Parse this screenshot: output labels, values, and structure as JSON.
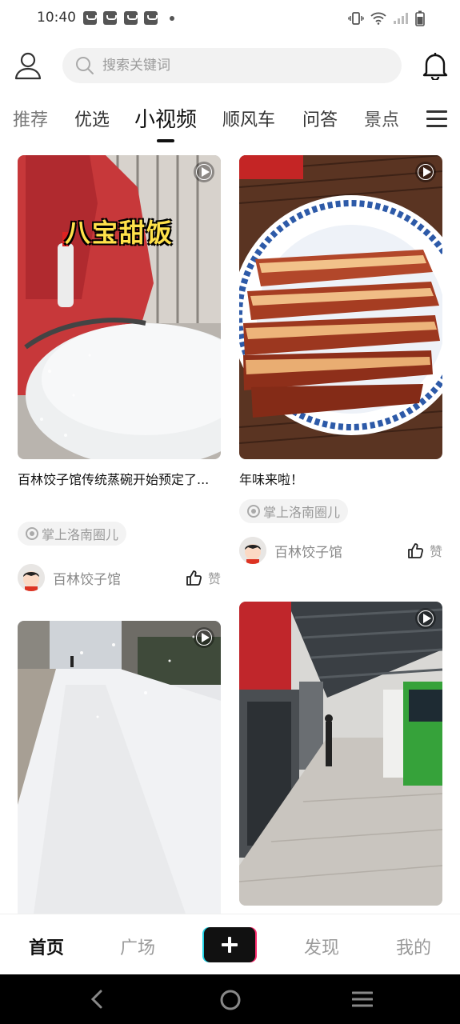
{
  "status_bar": {
    "time": "10:40"
  },
  "header": {
    "search_placeholder": "搜索关键词"
  },
  "tabs": [
    {
      "label": "推荐"
    },
    {
      "label": "优选"
    },
    {
      "label": "小视频"
    },
    {
      "label": "顺风车"
    },
    {
      "label": "问答"
    },
    {
      "label": "景点"
    }
  ],
  "active_tab": "小视频",
  "feed": {
    "cards": [
      {
        "overlay_text": "八宝甜饭",
        "title": "百林饺子馆传统蒸碗开始预定了...",
        "tag": "掌上洛南圈儿",
        "author": "百林饺子馆",
        "like_label": "赞"
      },
      {
        "title": "年味来啦！",
        "tag": "掌上洛南圈儿",
        "author": "百林饺子馆",
        "like_label": "赞"
      },
      {
        "title": ""
      },
      {
        "title": ""
      }
    ]
  },
  "bottom_nav": {
    "items": [
      {
        "label": "首页"
      },
      {
        "label": "广场"
      },
      {
        "label": "发现"
      },
      {
        "label": "我的"
      }
    ],
    "active": "首页"
  },
  "colors": {
    "accent_cyan": "#22d3e6",
    "accent_pink": "#ff2d6f",
    "text_dark": "#111111",
    "text_muted": "#9a9a9a"
  },
  "icons": [
    "user-icon",
    "search-icon",
    "bell-icon",
    "menu-icon",
    "play-icon",
    "like-icon",
    "plus-icon",
    "back-icon",
    "home-icon",
    "recents-icon"
  ]
}
